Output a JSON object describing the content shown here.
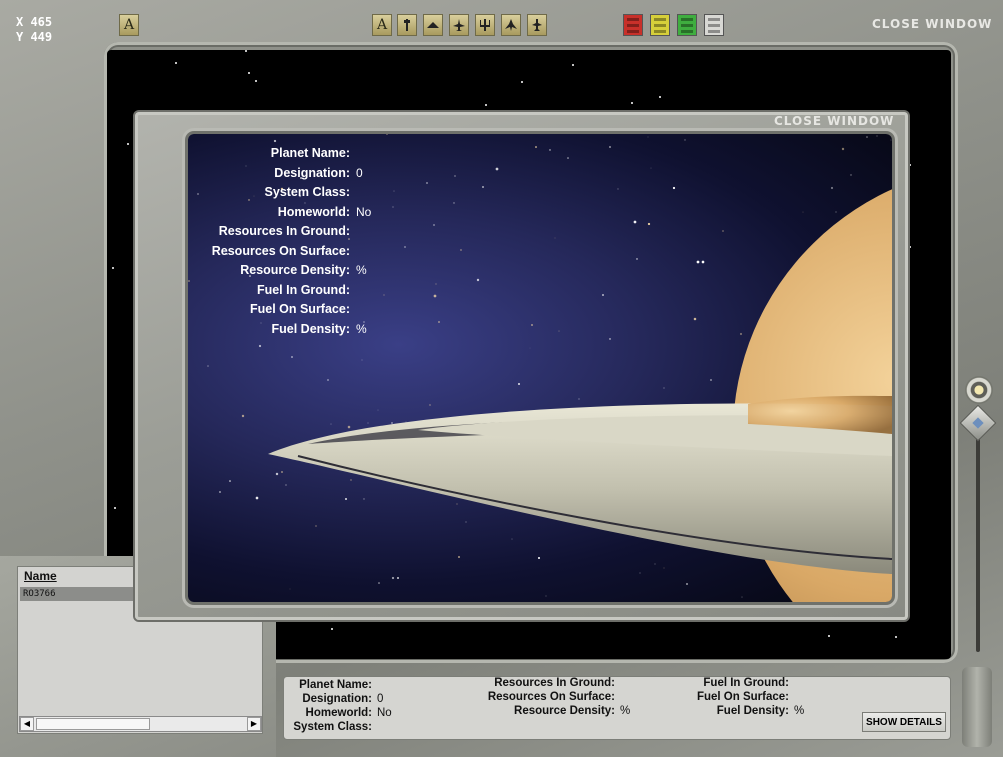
{
  "coords": {
    "x": "X 465",
    "y": "Y 449"
  },
  "toolbar": {
    "text_tool": "A",
    "font_tool": "A",
    "close_window": "CLOSE WINDOW",
    "icons": [
      "text-tool-icon",
      "font-icon",
      "pin-icon",
      "wedge-icon",
      "fighter-icon",
      "trident-icon",
      "bomber-icon",
      "cross-icon"
    ],
    "color_buttons": [
      {
        "name": "red-filter",
        "color": "#c8302a"
      },
      {
        "name": "yellow-filter",
        "color": "#d6cf3a"
      },
      {
        "name": "green-filter",
        "color": "#3fae3f"
      },
      {
        "name": "white-filter",
        "color": "#d8d8d4"
      }
    ]
  },
  "planet_list": {
    "header": "Name",
    "rows": [
      "RO3766"
    ]
  },
  "bottom_info": {
    "planet_name_label": "Planet Name:",
    "planet_name_value": "",
    "designation_label": "Designation:",
    "designation_value": "0",
    "homeworld_label": "Homeworld:",
    "homeworld_value": "No",
    "system_class_label": "System Class:",
    "system_class_value": "",
    "res_ground_label": "Resources In Ground:",
    "res_ground_value": "",
    "res_surface_label": "Resources On Surface:",
    "res_surface_value": "",
    "res_density_label": "Resource Density:",
    "res_density_value": "%",
    "fuel_ground_label": "Fuel In Ground:",
    "fuel_ground_value": "",
    "fuel_surface_label": "Fuel On Surface:",
    "fuel_surface_value": "",
    "fuel_density_label": "Fuel Density:",
    "fuel_density_value": "%",
    "show_details": "SHOW DETAILS"
  },
  "dialog": {
    "close_window": "CLOSE WINDOW",
    "fields": [
      {
        "label": "Planet Name:",
        "value": ""
      },
      {
        "label": "Designation:",
        "value": "0"
      },
      {
        "label": "System Class:",
        "value": ""
      },
      {
        "label": "Homeworld:",
        "value": "No"
      },
      {
        "label": "Resources In Ground:",
        "value": ""
      },
      {
        "label": "Resources On Surface:",
        "value": ""
      },
      {
        "label": "Resource Density:",
        "value": "%"
      },
      {
        "label": "Fuel In Ground:",
        "value": ""
      },
      {
        "label": "Fuel On Surface:",
        "value": ""
      },
      {
        "label": "Fuel Density:",
        "value": "%"
      }
    ]
  }
}
